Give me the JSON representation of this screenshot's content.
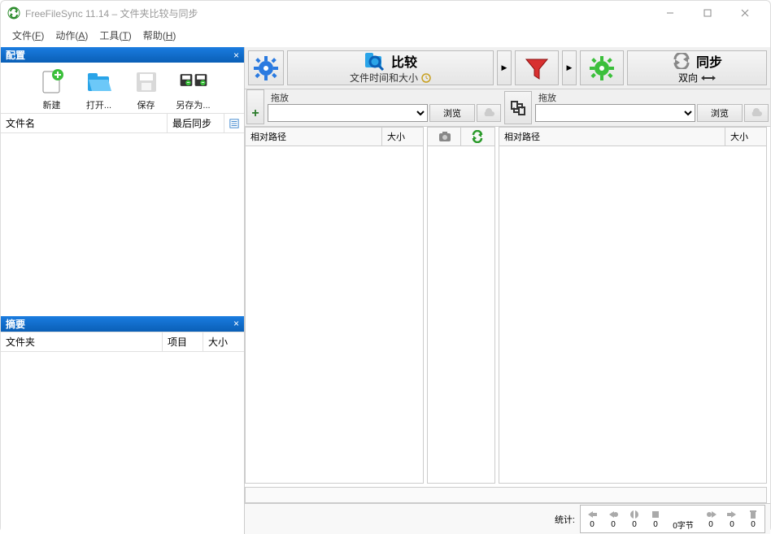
{
  "window": {
    "title": "FreeFileSync 11.14 – 文件夹比较与同步"
  },
  "menu": {
    "file": "文件(F)",
    "actions": "动作(A)",
    "tools": "工具(T)",
    "help": "帮助(H)"
  },
  "config_panel": {
    "title": "配置",
    "toolbar": {
      "new_label": "新建",
      "open_label": "打开...",
      "save_label": "保存",
      "save_as_label": "另存为..."
    },
    "columns": {
      "name": "文件名",
      "last_sync": "最后同步"
    }
  },
  "summary_panel": {
    "title": "摘要",
    "columns": {
      "folder": "文件夹",
      "items": "项目",
      "size": "大小"
    }
  },
  "top_toolbar": {
    "compare_label": "比较",
    "compare_sub": "文件时间和大小",
    "sync_label": "同步",
    "sync_sub": "双向"
  },
  "folder_pair": {
    "left_drop": "拖放",
    "right_drop": "拖放",
    "browse": "浏览"
  },
  "grid": {
    "left": {
      "path": "相对路径",
      "size": "大小"
    },
    "right": {
      "path": "相对路径",
      "size": "大小"
    }
  },
  "status": {
    "label": "统计:",
    "vals": {
      "a": "0",
      "b": "0",
      "c": "0",
      "d": "0",
      "bytes": "0字节",
      "e": "0",
      "f": "0",
      "g": "0"
    }
  }
}
